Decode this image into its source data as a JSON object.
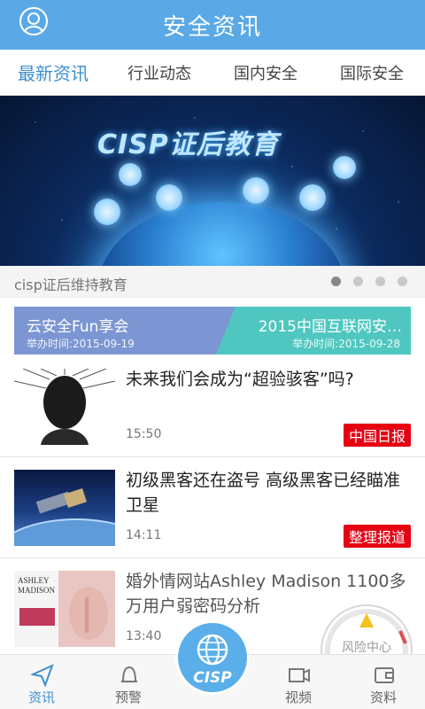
{
  "header": {
    "title": "安全资讯",
    "icon": "user-icon"
  },
  "tabs": [
    {
      "label": "最新资讯",
      "active": true
    },
    {
      "label": "行业动态",
      "active": false
    },
    {
      "label": "国内安全",
      "active": false
    },
    {
      "label": "国际安全",
      "active": false
    }
  ],
  "banner": {
    "title": "CISP证后教育",
    "caption": "cisp证后维持教育",
    "slide_count": 4,
    "active_slide": 1
  },
  "events": [
    {
      "name": "云安全Fun享会",
      "time": "举办时间:2015-09-19",
      "color": "#7b96d2"
    },
    {
      "name": "2015中国互联网安…",
      "time": "举办时间:2015-09-28",
      "color": "#4fc7c0"
    }
  ],
  "news": [
    {
      "title": "未来我们会成为“超验骇客”吗?",
      "time": "15:50",
      "source": "中国日报"
    },
    {
      "title": "初级黑客还在盗号 高级黑客已经瞄准卫星",
      "time": "14:11",
      "source": "整理报道"
    },
    {
      "title": "婚外情网站Ashley Madison 1100多万用户弱密码分析",
      "time": "13:40",
      "source": ""
    }
  ],
  "thumb3_text": {
    "brand1": "ASHLEY",
    "brand2": "MADISON"
  },
  "nav": [
    {
      "label": "资讯",
      "icon": "paper-plane-icon",
      "active": true
    },
    {
      "label": "预警",
      "icon": "bell-icon",
      "active": false
    },
    {
      "label": "CISP",
      "icon": "globe-icon",
      "active": false
    },
    {
      "label": "视频",
      "icon": "video-icon",
      "active": false
    },
    {
      "label": "资料",
      "icon": "wallet-icon",
      "active": false
    }
  ],
  "risk_center": {
    "label": "风险中心"
  },
  "colors": {
    "primary": "#5aa9e6",
    "tab_active": "#3d8fd1",
    "badge": "#e60012"
  }
}
